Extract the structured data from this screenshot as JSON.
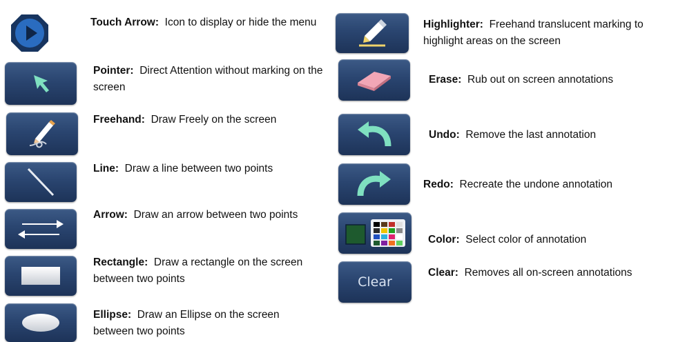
{
  "tools_left": [
    {
      "name": "Touch Arrow:",
      "desc": "Icon to display or hide the menu",
      "icon": "touch-arrow-icon"
    },
    {
      "name": "Pointer:",
      "desc": "Direct Attention without marking on the screen",
      "icon": "pointer-icon"
    },
    {
      "name": "Freehand:",
      "desc": "Draw Freely on the screen",
      "icon": "freehand-icon"
    },
    {
      "name": "Line:",
      "desc": "Draw a line between two points",
      "icon": "line-icon"
    },
    {
      "name": "Arrow:",
      "desc": "Draw an arrow between two points",
      "icon": "arrow-icon"
    },
    {
      "name": "Rectangle:",
      "desc": "Draw a rectangle on the screen between two points",
      "icon": "rectangle-icon"
    },
    {
      "name": "Ellipse:",
      "desc": "Draw an Ellipse on the screen between two points",
      "icon": "ellipse-icon"
    }
  ],
  "tools_right": [
    {
      "name": "Highlighter:",
      "desc": "Freehand translucent marking to highlight areas on the screen",
      "icon": "highlighter-icon"
    },
    {
      "name": "Erase:",
      "desc": "Rub out on screen annotations",
      "icon": "eraser-icon"
    },
    {
      "name": "Undo:",
      "desc": "Remove the last annotation",
      "icon": "undo-icon"
    },
    {
      "name": "Redo:",
      "desc": "Recreate the undone annotation",
      "icon": "redo-icon"
    },
    {
      "name": "Color:",
      "desc": "Select color of annotation",
      "icon": "color-palette-icon"
    },
    {
      "name": "Clear:",
      "desc": "Removes all on-screen annotations",
      "icon": "clear-icon",
      "button_label": "Clear"
    }
  ],
  "colors": {
    "button": "#2a4570",
    "accent": "#7fe0c0",
    "touch_circle": "#1f5fa8",
    "selected_color": "#1e5a2e"
  }
}
